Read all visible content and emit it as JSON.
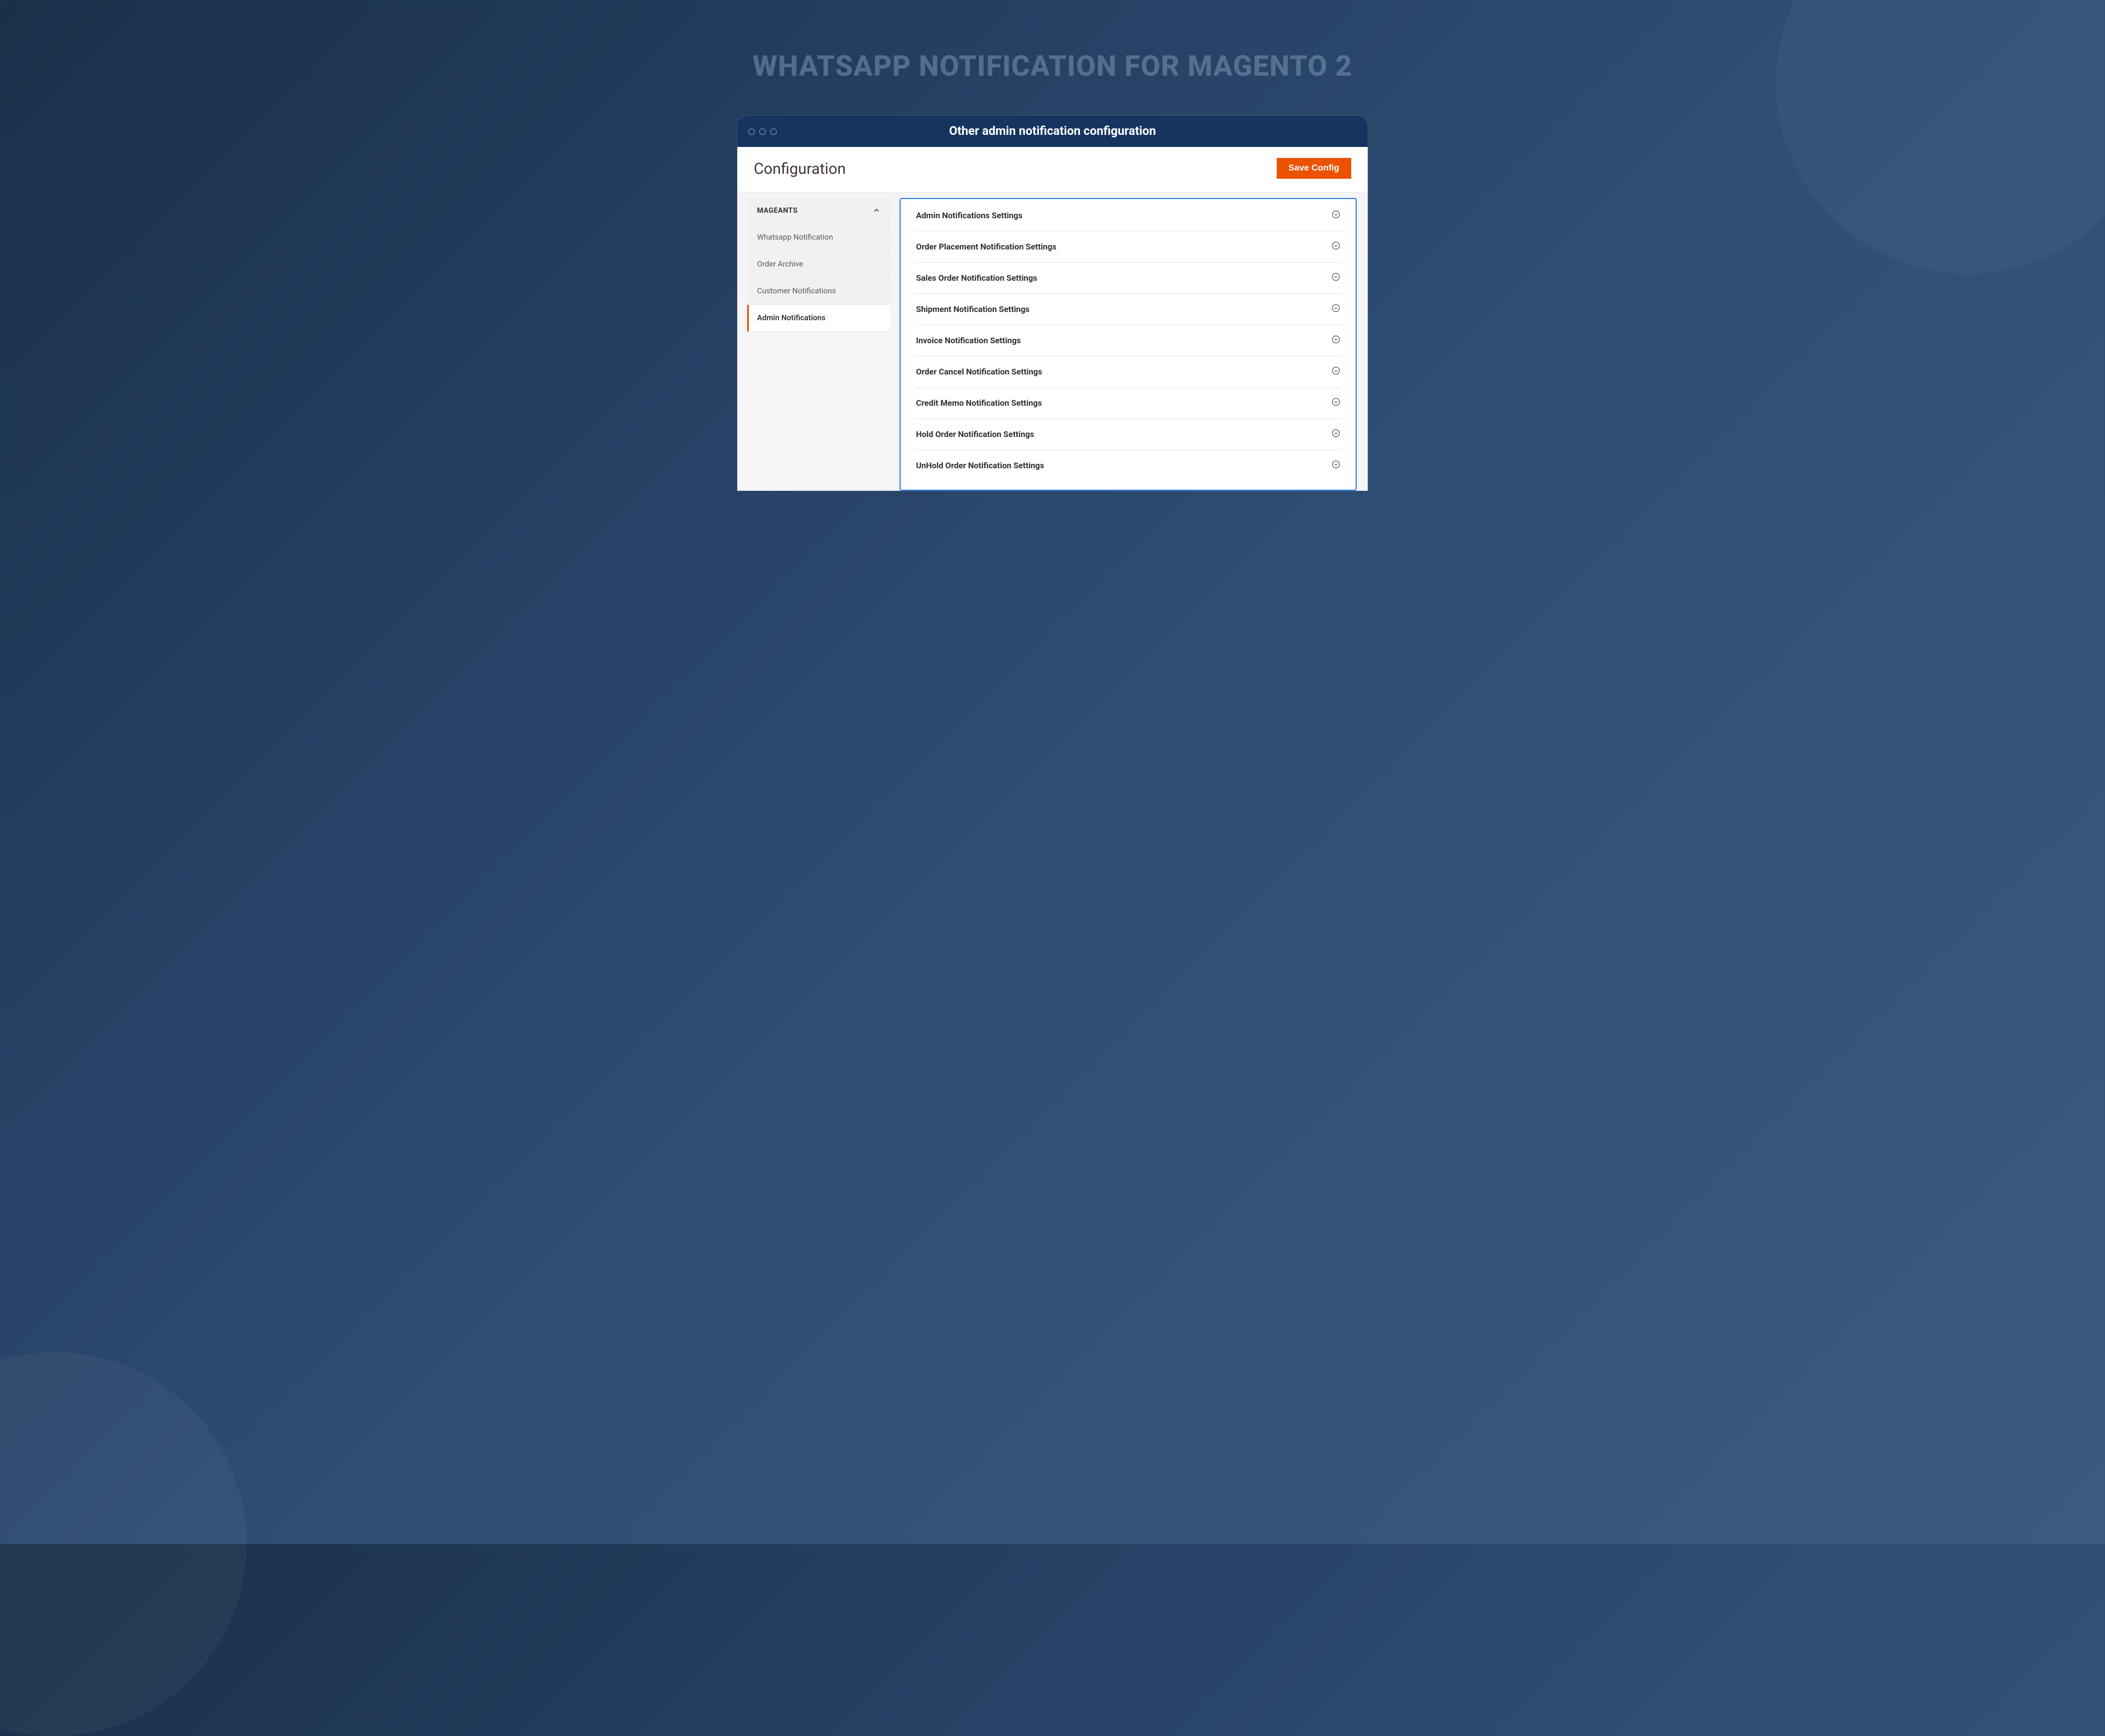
{
  "hero": {
    "title": "WHATSAPP NOTIFICATION FOR MAGENTO 2"
  },
  "window": {
    "title": "Other admin notification configuration"
  },
  "page": {
    "title": "Configuration",
    "save_button": "Save Config"
  },
  "sidebar": {
    "group_title": "MAGEANTS",
    "items": [
      {
        "label": "Whatsapp Notification",
        "active": false
      },
      {
        "label": "Order Archive",
        "active": false
      },
      {
        "label": "Customer Notifications",
        "active": false
      },
      {
        "label": "Admin Notifications",
        "active": true
      }
    ]
  },
  "settings": [
    {
      "label": "Admin Notifications Settings"
    },
    {
      "label": "Order Placement Notification Settings"
    },
    {
      "label": "Sales Order Notification Settings"
    },
    {
      "label": "Shipment Notification Settings"
    },
    {
      "label": "Invoice Notification Settings"
    },
    {
      "label": "Order Cancel Notification Settings"
    },
    {
      "label": "Credit Memo Notification Settings"
    },
    {
      "label": "Hold Order Notification Settings"
    },
    {
      "label": "UnHold Order Notification Settings"
    }
  ],
  "colors": {
    "accent": "#eb5202",
    "panel_border": "#2b7de9"
  }
}
